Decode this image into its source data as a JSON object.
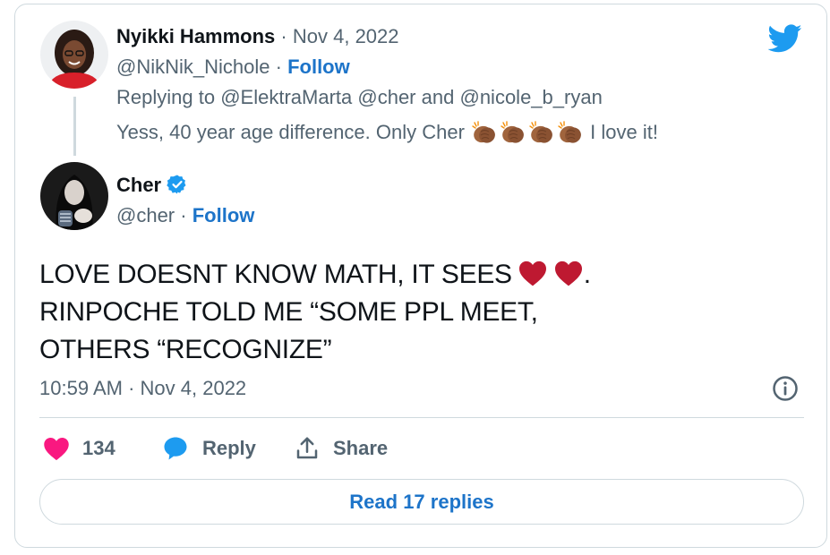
{
  "reply_tweet": {
    "author_name": "Nyikki Hammons",
    "date_sep": "·",
    "date": "Nov 4, 2022",
    "handle": "@NikNik_Nichole",
    "handle_sep": "·",
    "follow_label": "Follow",
    "replying_prefix": "Replying to",
    "replying_to_1": "@ElektraMarta",
    "replying_to_2": "@cher",
    "replying_and": "and",
    "replying_to_3": "@nicole_b_ryan",
    "text_before": "Yess, 40 year age difference. Only Cher",
    "emoji": "clapping-hands-medium-dark-skin",
    "emoji_count": 4,
    "text_after": "I love it!"
  },
  "main_tweet": {
    "author_name": "Cher",
    "verified": true,
    "handle": "@cher",
    "handle_sep": "·",
    "follow_label": "Follow",
    "line1": "LOVE DOESNT KNOW MATH, IT SEES",
    "line1_end": ".",
    "line1_emoji": "red-heart",
    "line2": "RINPOCHE TOLD ME “SOME PPL MEET,",
    "line3": "OTHERS “RECOGNIZE”",
    "time": "10:59 AM",
    "date_sep": "·",
    "date": "Nov 4, 2022"
  },
  "actions": {
    "like_count": "134",
    "reply_label": "Reply",
    "share_label": "Share"
  },
  "read_replies_label": "Read 17 replies",
  "colors": {
    "accent": "#1d74c9",
    "twitter_blue": "#1d9bf0",
    "like_pink": "#f91880",
    "muted": "#536471",
    "border": "#cfd9de"
  }
}
